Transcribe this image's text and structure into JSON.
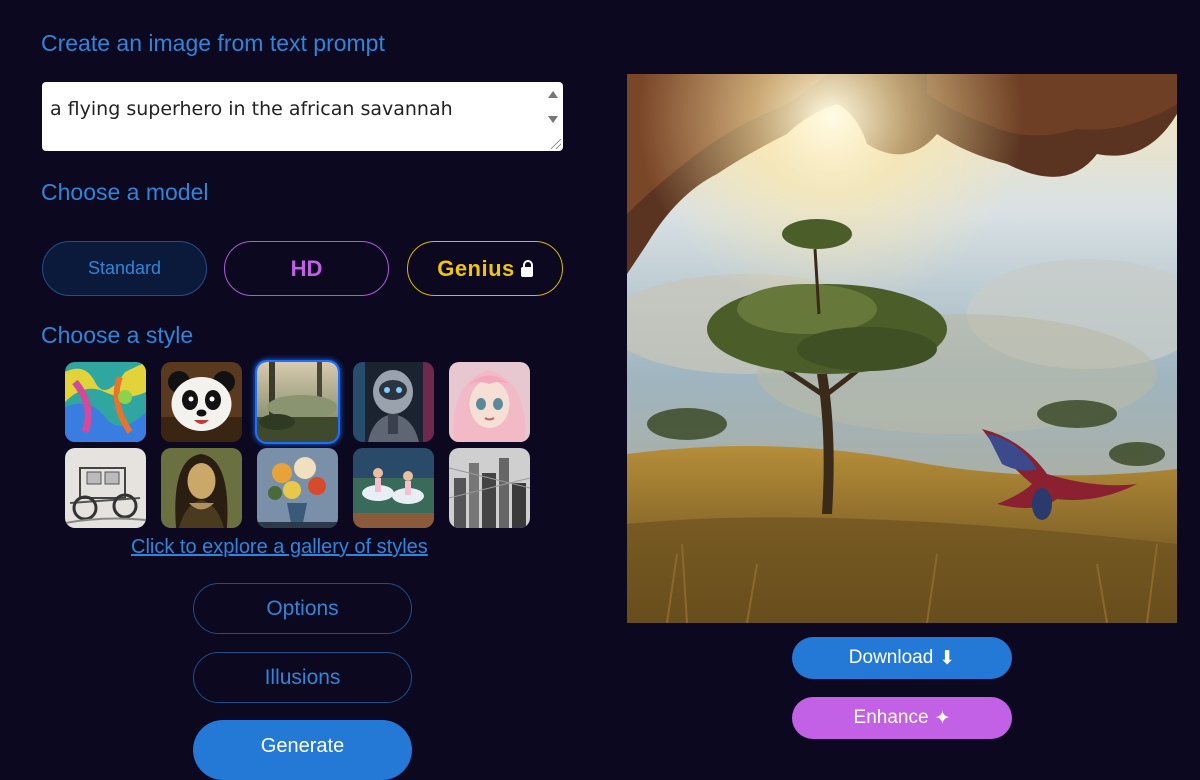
{
  "headings": {
    "prompt": "Create an image from text prompt",
    "model": "Choose a model",
    "style": "Choose a style"
  },
  "prompt": {
    "value": "a flying superhero in the african savannah"
  },
  "models": {
    "standard": "Standard",
    "hd": "HD",
    "genius": "Genius",
    "genius_icon": "lock-icon"
  },
  "styles": {
    "selected_index": 2,
    "row1": [
      "abstract-paint",
      "panda-cartoon",
      "landscape-painting",
      "robot-portrait",
      "anime-girl"
    ],
    "row2": [
      "pencil-car-sketch",
      "renaissance-portrait",
      "flower-still-life",
      "ballet-impressionist",
      "ink-cityscape"
    ]
  },
  "gallery_link": "Click to explore a gallery of styles",
  "buttons": {
    "options": "Options",
    "illusions": "Illusions",
    "generate": "Generate",
    "download": "Download",
    "download_icon": "⬇",
    "enhance": "Enhance",
    "enhance_icon": "✦"
  },
  "colors": {
    "background": "#0b0820",
    "accent_blue": "#2f86d9",
    "button_blue": "#2479d6",
    "hd_purple": "#c35fe6",
    "genius_gold": "#f1c40f",
    "enhance_purple": "#c261e6"
  }
}
